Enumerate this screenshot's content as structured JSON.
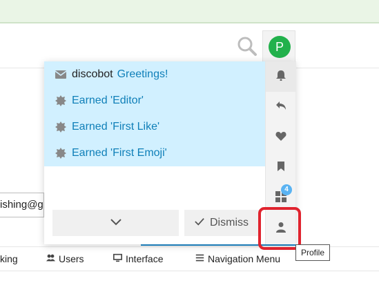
{
  "header": {
    "avatar_letter": "P",
    "avatar_color": "#22b14c"
  },
  "notifications": [
    {
      "icon": "envelope-icon",
      "sender": "discobot",
      "text": "Greetings!"
    },
    {
      "icon": "badge-icon",
      "sender": "",
      "text": "Earned 'Editor'"
    },
    {
      "icon": "badge-icon",
      "sender": "",
      "text": "Earned 'First Like'"
    },
    {
      "icon": "badge-icon",
      "sender": "",
      "text": "Earned 'First Emoji'"
    }
  ],
  "footer": {
    "dismiss_label": "Dismiss"
  },
  "tabs": [
    {
      "icon": "bell-icon"
    },
    {
      "icon": "reply-icon"
    },
    {
      "icon": "heart-icon"
    },
    {
      "icon": "bookmark-icon"
    },
    {
      "icon": "grid-icon",
      "badge": "4"
    },
    {
      "icon": "user-icon",
      "tooltip": "Profile"
    }
  ],
  "background": {
    "email_fragment": "ishing@g",
    "nav_items": [
      {
        "label": "king",
        "icon": ""
      },
      {
        "label": "Users",
        "icon": "users-icon"
      },
      {
        "label": "Interface",
        "icon": "monitor-icon"
      },
      {
        "label": "Navigation Menu",
        "icon": "menu-icon"
      }
    ]
  },
  "colors": {
    "accent": "#0f7fb8",
    "notification_bg": "#d1f0ff",
    "highlight_red": "#e0232e",
    "badge_blue": "#5ab3f2"
  }
}
